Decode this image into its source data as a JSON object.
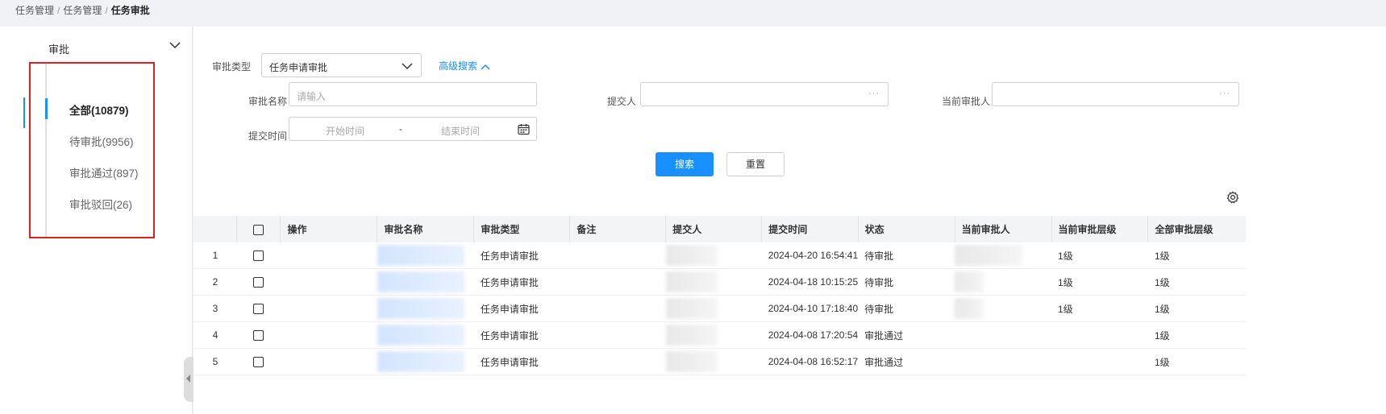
{
  "breadcrumb": {
    "items": [
      "任务管理",
      "任务管理"
    ],
    "sep": "/",
    "current": "任务审批"
  },
  "sidebar": {
    "title": "审批",
    "items": [
      {
        "label": "全部(10879)",
        "active": true
      },
      {
        "label": "待审批(9956)"
      },
      {
        "label": "审批通过(897)"
      },
      {
        "label": "审批驳回(26)"
      }
    ]
  },
  "filters": {
    "type_label": "审批类型",
    "type_value": "任务申请审批",
    "advanced_label": "高级搜索",
    "name_label": "审批名称",
    "name_placeholder": "请输入",
    "submitter_label": "提交人",
    "current_approver_label": "当前审批人",
    "picker_dots": "···",
    "time_label": "提交时间",
    "start_placeholder": "开始时间",
    "range_sep": "-",
    "end_placeholder": "结束时间"
  },
  "buttons": {
    "search": "搜索",
    "reset": "重置"
  },
  "table": {
    "columns": [
      "操作",
      "审批名称",
      "审批类型",
      "备注",
      "提交人",
      "提交时间",
      "状态",
      "当前审批人",
      "当前审批层级",
      "全部审批层级"
    ],
    "rows": [
      {
        "index": "1",
        "type": "任务申请审批",
        "time": "2024-04-20 16:54:41",
        "status": "待审批",
        "current_level": "1级",
        "total_level": "1级",
        "has_approver": true
      },
      {
        "index": "2",
        "type": "任务申请审批",
        "time": "2024-04-18 10:15:25",
        "status": "待审批",
        "current_level": "1级",
        "total_level": "1级",
        "has_approver": true
      },
      {
        "index": "3",
        "type": "任务申请审批",
        "time": "2024-04-10 17:18:40",
        "status": "待审批",
        "current_level": "1级",
        "total_level": "1级",
        "has_approver": true
      },
      {
        "index": "4",
        "type": "任务申请审批",
        "time": "2024-04-08 17:20:54",
        "status": "审批通过",
        "current_level": "",
        "total_level": "1级",
        "has_approver": false
      },
      {
        "index": "5",
        "type": "任务申请审批",
        "time": "2024-04-08 16:52:17",
        "status": "审批通过",
        "current_level": "",
        "total_level": "1级",
        "has_approver": false
      }
    ]
  },
  "colors": {
    "primary": "#1890ff",
    "highlight": "#e02020"
  }
}
